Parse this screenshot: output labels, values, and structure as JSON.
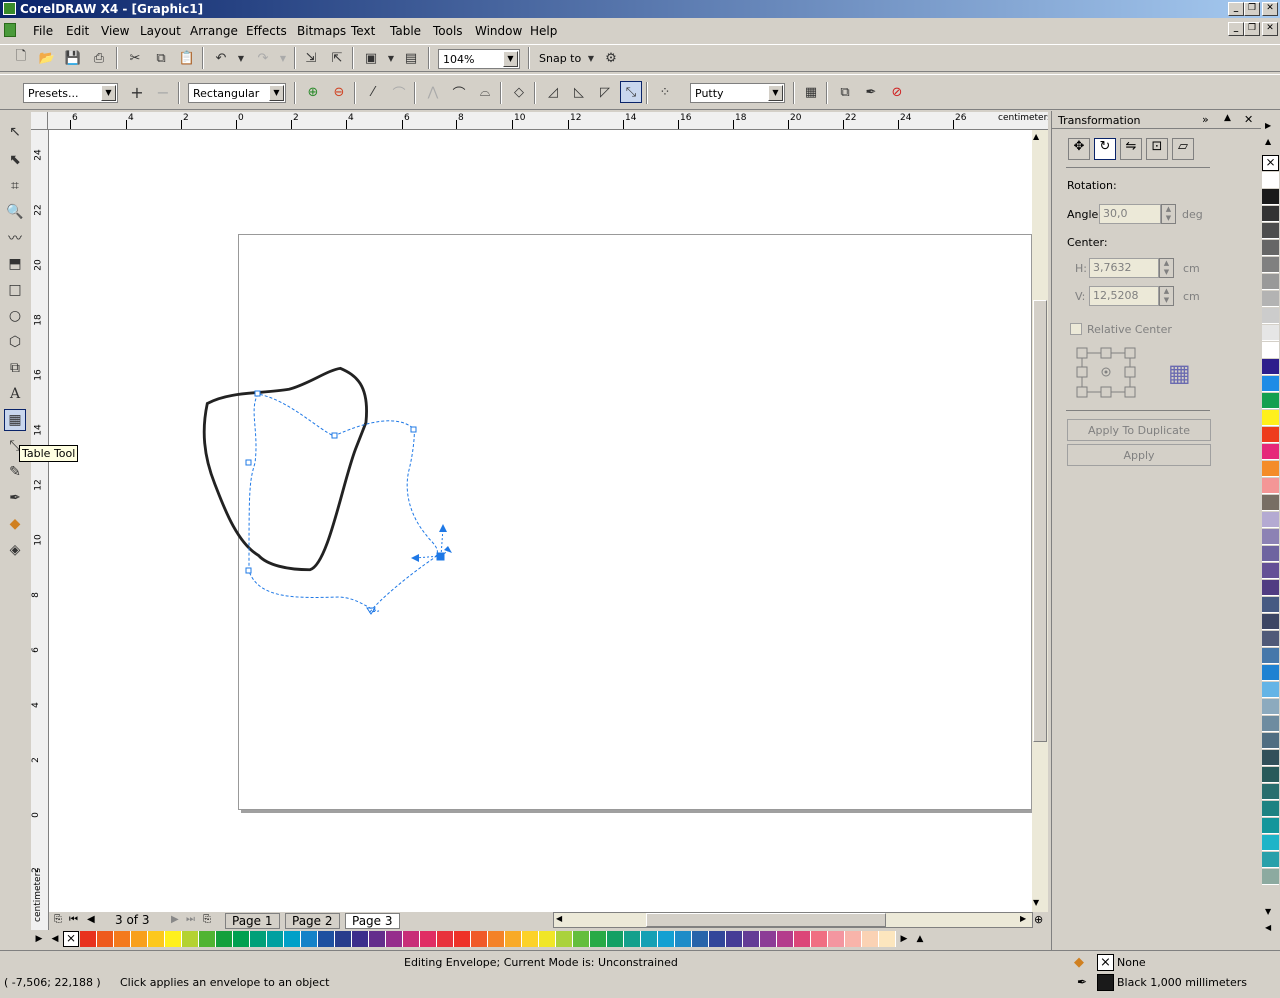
{
  "window": {
    "title": "CorelDRAW X4 - [Graphic1]"
  },
  "menu": [
    "File",
    "Edit",
    "View",
    "Layout",
    "Arrange",
    "Effects",
    "Bitmaps",
    "Text",
    "Table",
    "Tools",
    "Window",
    "Help"
  ],
  "toolbar": {
    "zoom": "104%",
    "snap_label": "Snap to"
  },
  "propbar": {
    "presets": "Presets...",
    "mode": "Rectangular",
    "mapping": "Putty"
  },
  "tooltip": "Table Tool",
  "rulers": {
    "unit": "centimeters",
    "h_ticks": [
      "6",
      "4",
      "2",
      "0",
      "2",
      "4",
      "6",
      "8",
      "10",
      "12",
      "14",
      "16",
      "18",
      "20",
      "22",
      "24",
      "26"
    ],
    "v_ticks": [
      "24",
      "22",
      "20",
      "18",
      "16",
      "14",
      "12",
      "10",
      "8",
      "6",
      "4",
      "2",
      "0",
      "2"
    ]
  },
  "pagenav": {
    "counter": "3 of 3",
    "pages": [
      "Page 1",
      "Page 2",
      "Page 3"
    ],
    "active": 2
  },
  "docker": {
    "title": "Transformation",
    "rotation_label": "Rotation:",
    "angle_label": "Angle:",
    "angle_value": "30,0",
    "angle_unit": "deg",
    "center_label": "Center:",
    "h_label": "H:",
    "h_value": "3,7632",
    "h_unit": "cm",
    "v_label": "V:",
    "v_value": "12,5208",
    "v_unit": "cm",
    "relative_center": "Relative Center",
    "apply_dup": "Apply To Duplicate",
    "apply": "Apply"
  },
  "status": {
    "message": "Editing Envelope;  Current Mode is: Unconstrained",
    "coords": "( -7,506; 22,188 )",
    "hint": "Click applies an envelope to an object",
    "fill": "None",
    "outline": "Black  1,000 millimeters"
  },
  "colors": {
    "bottom_palette": [
      "#e8321e",
      "#ee5a1c",
      "#f47a1c",
      "#f8a01c",
      "#fcc81c",
      "#fff01c",
      "#b4d232",
      "#50b432",
      "#14a03c",
      "#00a050",
      "#00a078",
      "#00a0a0",
      "#00a0c8",
      "#1482c8",
      "#1e50a0",
      "#283c8c",
      "#3c2d8c",
      "#642d8c",
      "#962d8c",
      "#c82d78",
      "#e02d64",
      "#e8323c",
      "#ee3228",
      "#f05a28",
      "#f48228",
      "#f8aa28",
      "#fcd228",
      "#f0e628",
      "#aad23c",
      "#64be3c",
      "#28aa46",
      "#14a064",
      "#14a08c",
      "#14a0b4",
      "#14a0d2",
      "#1e8cc8",
      "#2864aa",
      "#32469a",
      "#463c96",
      "#643c96",
      "#8c3c96",
      "#b43c8c",
      "#dc4678",
      "#f06e82",
      "#f496a0",
      "#f8b4aa",
      "#fad2b4",
      "#fce6be"
    ],
    "right_palette": [
      "#ffffff",
      "#1a1a1a",
      "#333333",
      "#4d4d4d",
      "#666666",
      "#808080",
      "#999999",
      "#b3b3b3",
      "#cccccc",
      "#e6e6e6",
      "#ffffff",
      "#2d1e8c",
      "#1e8ce6",
      "#14a050",
      "#fff01c",
      "#ee3c1c",
      "#e6287a",
      "#f48c28",
      "#f49696",
      "#786e64",
      "#b4aad2",
      "#8c82b4",
      "#6e64a0",
      "#645096",
      "#503c82",
      "#465a82",
      "#3c4664",
      "#505a78",
      "#4678aa",
      "#1e82d2",
      "#64b4e6",
      "#8caabe",
      "#6e8ca0",
      "#506e82",
      "#32505a",
      "#285a5a",
      "#286e6e",
      "#1e8282",
      "#14969b",
      "#1eb4c8",
      "#28a0aa",
      "#8caaa0"
    ]
  }
}
